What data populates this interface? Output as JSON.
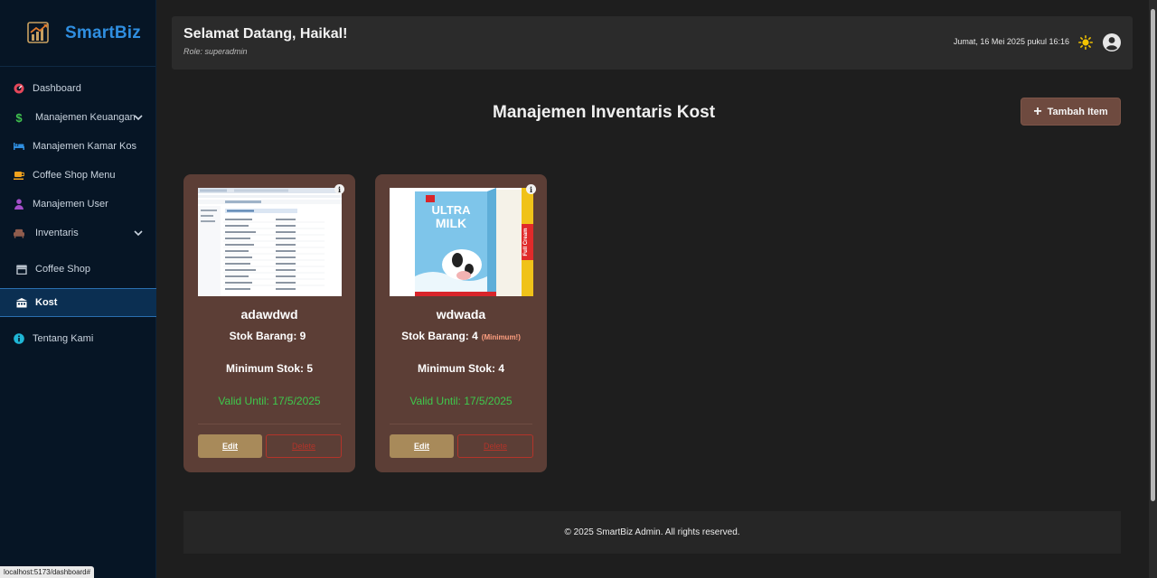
{
  "brand": {
    "name": "SmartBiz"
  },
  "sidebar": {
    "items": [
      {
        "label": "Dashboard",
        "icon": "dashboard-gauge-icon",
        "color": "#e4475a"
      },
      {
        "label": "Manajemen Keuangan",
        "icon": "dollar-icon",
        "color": "#41c34f"
      },
      {
        "label": "Manajemen Kamar Kos",
        "icon": "bed-icon",
        "color": "#2f8ee0"
      },
      {
        "label": "Coffee Shop Menu",
        "icon": "coffee-icon",
        "color": "#f1a21d"
      },
      {
        "label": "Manajemen User",
        "icon": "user-icon",
        "color": "#a44ec9"
      },
      {
        "label": "Inventaris",
        "icon": "couch-icon",
        "color": "#8f5c4d"
      },
      {
        "label": "Coffee Shop",
        "icon": "store-icon",
        "color": "#b9c3cd"
      },
      {
        "label": "Kost",
        "icon": "building-icon",
        "color": "#ffffff"
      },
      {
        "label": "Tentang Kami",
        "icon": "info-icon",
        "color": "#1fb6d6"
      }
    ],
    "status_url": "localhost:5173/dashboard#"
  },
  "header": {
    "welcome": "Selamat Datang, Haikal!",
    "role": "Role: superadmin",
    "datetime": "Jumat, 16 Mei 2025 pukul 16:16"
  },
  "main": {
    "title": "Manajemen Inventaris Kost",
    "add_button": "Tambah Item",
    "cards": [
      {
        "name": "adawdwd",
        "stock": "Stok Barang: 9",
        "warning": "",
        "min_stock": "Minimum Stok: 5",
        "valid_until": "Valid Until: 17/5/2025",
        "edit": "Edit",
        "delete": "Delete"
      },
      {
        "name": "wdwada",
        "stock": "Stok Barang: 4",
        "warning": "(Minimum!)",
        "min_stock": "Minimum Stok: 4",
        "valid_until": "Valid Until: 17/5/2025",
        "edit": "Edit",
        "delete": "Delete"
      }
    ]
  },
  "footer": {
    "text": "© 2025 SmartBiz Admin. All rights reserved."
  },
  "colors": {
    "sidebar_bg": "#061525",
    "brand": "#2f8ee0",
    "card_bg": "#5c3e36",
    "add_button_bg": "#6e4a3f",
    "valid_green": "#3ec94c",
    "delete_red": "#b3342a"
  }
}
